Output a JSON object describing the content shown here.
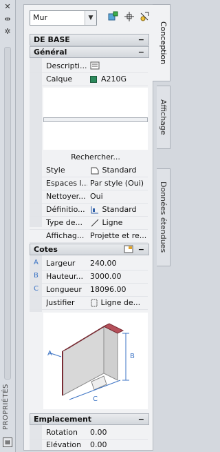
{
  "panel_label": "PROPRIÉTÉS",
  "combo": {
    "value": "Mur"
  },
  "sections": {
    "base": "DE BASE",
    "general": "Général",
    "cotes": "Cotes",
    "emplacement": "Emplacement"
  },
  "general_rows": [
    {
      "label": "Descripti...",
      "value": ""
    },
    {
      "label": "Calque",
      "value": "A210G"
    }
  ],
  "search_label": "Rechercher...",
  "style_rows": [
    {
      "label": "Style",
      "value": "Standard"
    },
    {
      "label": "Espaces l...",
      "value": "Par style (Oui)"
    },
    {
      "label": "Nettoyer...",
      "value": "Oui"
    },
    {
      "label": "Définitio...",
      "value": "Standard"
    },
    {
      "label": "Type de...",
      "value": "Ligne"
    },
    {
      "label": "Affichag...",
      "value": "Projette et re..."
    }
  ],
  "cotes_rows": [
    {
      "letter": "A",
      "label": "Largeur",
      "value": "240.00"
    },
    {
      "letter": "B",
      "label": "Hauteur...",
      "value": "3000.00"
    },
    {
      "letter": "C",
      "label": "Longueur",
      "value": "18096.00"
    },
    {
      "letter": "",
      "label": "Justifier",
      "value": "Ligne de..."
    }
  ],
  "diagram_labels": {
    "a": "A",
    "b": "B",
    "c": "C"
  },
  "emplacement_rows": [
    {
      "label": "Rotation",
      "value": "0.00"
    },
    {
      "label": "Elévation",
      "value": "0.00"
    }
  ],
  "tabs": [
    "Conception",
    "Affichage",
    "Données étendues"
  ],
  "colors": {
    "layer_swatch": "#2c8a5c",
    "wall_top": "#b5505a",
    "dim_lines": "#3b73c4"
  }
}
